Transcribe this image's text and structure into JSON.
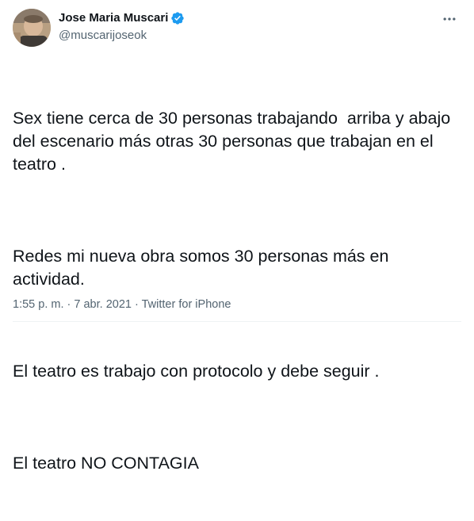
{
  "author": {
    "display_name": "Jose Maria Muscari",
    "handle": "@muscarijoseok",
    "verified": true,
    "avatar_icon": "profile-photo"
  },
  "actions": {
    "more_icon": "more-horizontal-icon"
  },
  "tweet": {
    "paragraphs": [
      "Sex tiene cerca de 30 personas trabajando  arriba y abajo del escenario más otras 30 personas que trabajan en el teatro .",
      "Redes mi nueva obra somos 30 personas más en actividad.",
      "El teatro es trabajo con protocolo y debe seguir .",
      "El teatro NO CONTAGIA"
    ]
  },
  "meta": {
    "time": "1:55 p. m.",
    "separator": "·",
    "date": "7 abr. 2021",
    "source": "Twitter for iPhone"
  },
  "colors": {
    "text_primary": "#0f1419",
    "text_secondary": "#536471",
    "verified_blue": "#1d9bf0"
  }
}
